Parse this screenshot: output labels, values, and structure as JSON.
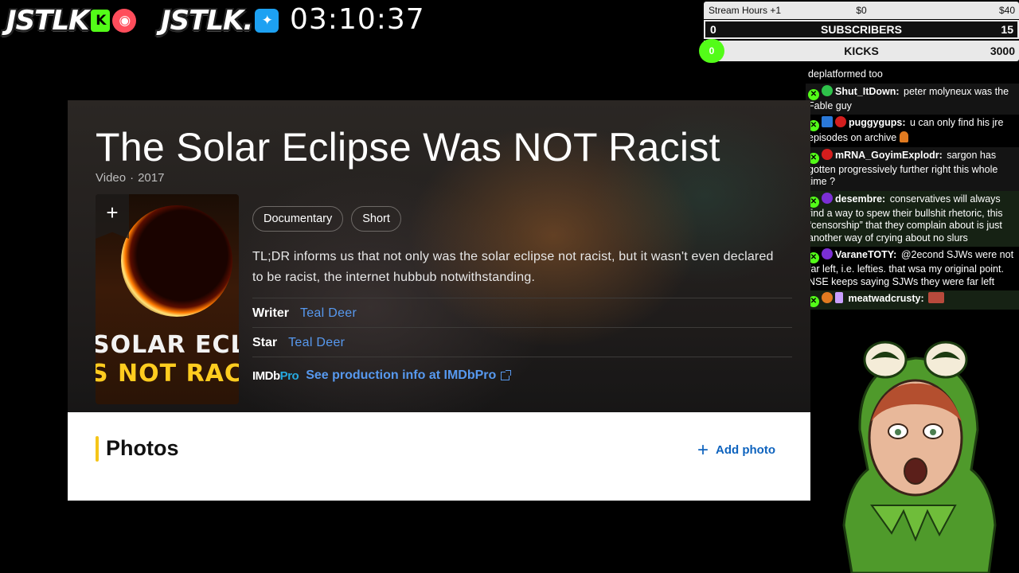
{
  "overlay": {
    "logo_primary": "JSTLK",
    "logo_secondary": "JSTLK.",
    "timer": "03:10:37"
  },
  "goals": {
    "hours": {
      "label": "Stream Hours +1",
      "mid": "$0",
      "right": "$40"
    },
    "subscribers": {
      "left": "0",
      "label": "SUBSCRIBERS",
      "right": "15"
    },
    "kicks": {
      "left": "0",
      "label": "KICKS",
      "right": "3000",
      "progress": 0
    }
  },
  "chat": {
    "messages": [
      {
        "user": "",
        "text": "deplatformed too"
      },
      {
        "user": "Shut_ItDown:",
        "text": " peter molyneux was the Fable guy"
      },
      {
        "user": "puggygups:",
        "text": " u can only find his jre episodes on archive"
      },
      {
        "user": "mRNA_GoyimExplodr:",
        "text": " sargon has gotten progressively further right this whole time ?"
      },
      {
        "user": "desembre:",
        "text": " conservatives will always find a way to spew their bullshit rhetoric, this “censorship” that they complain about is just another way of crying about no slurs"
      },
      {
        "user": "VaraneTOTY:",
        "text": " @2econd SJWs were not far left, i.e. lefties. that wsa my original point. NSE keeps saying SJWs they were far left"
      },
      {
        "user": "meatwadcrusty:",
        "text": ""
      }
    ],
    "colors": {
      "accent": "#53fc18"
    }
  },
  "imdb": {
    "title": "The Solar Eclipse Was NOT Racist",
    "type": "Video",
    "separator": "·",
    "year": "2017",
    "poster": {
      "line1": "SOLAR ECLI",
      "line2": "S NOT RAC",
      "ribbon": "+"
    },
    "genres": [
      "Documentary",
      "Short"
    ],
    "plot": "TL;DR informs us that not only was the solar eclipse not racist, but it wasn't even declared to be racist, the internet hubbub notwithstanding.",
    "writer_label": "Writer",
    "writer": "Teal Deer",
    "star_label": "Star",
    "star": "Teal Deer",
    "pro_logo_a": "IMDb",
    "pro_logo_b": "Pro",
    "pro_link": "See production info at IMDbPro",
    "photos_title": "Photos",
    "add_photo": "Add photo",
    "colors": {
      "link": "#5799ef",
      "imdb_yellow": "#f5c518",
      "add_photo": "#0e63be"
    }
  }
}
